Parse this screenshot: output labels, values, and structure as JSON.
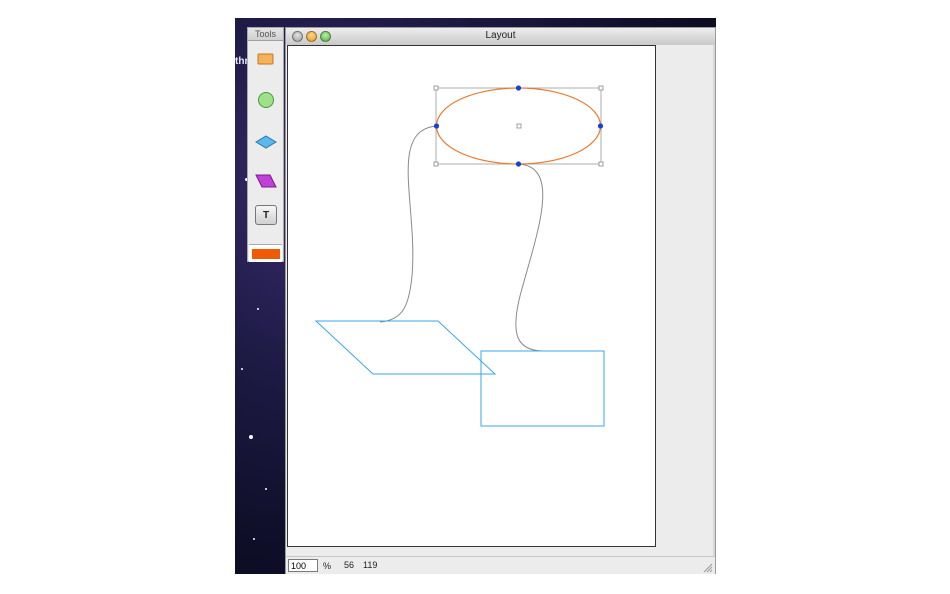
{
  "desktop": {
    "partial_text": "thr"
  },
  "tools_palette": {
    "title": "Tools",
    "tools": [
      {
        "name": "rectangle-tool",
        "icon": "rectangle-icon",
        "fill": "#f6b25a"
      },
      {
        "name": "ellipse-tool",
        "icon": "ellipse-icon",
        "fill": "#9fe08a"
      },
      {
        "name": "diamond-tool",
        "icon": "diamond-icon",
        "fill": "#5bb8ea"
      },
      {
        "name": "parallelogram-tool",
        "icon": "parallelogram-icon",
        "fill": "#c040d8"
      },
      {
        "name": "text-tool",
        "icon": "text-icon",
        "label": "T"
      }
    ],
    "current_color": "#f05a05"
  },
  "window": {
    "title": "Layout"
  },
  "status": {
    "zoom_value": "100",
    "zoom_unit": "%",
    "x": "56",
    "y": "119"
  },
  "colors": {
    "ellipse_stroke": "#e87a2c",
    "shape_stroke": "#3aa7e8",
    "connector": "#8a8a8a",
    "handle": "#1a3fd6",
    "selection": "#9a9a9a"
  }
}
